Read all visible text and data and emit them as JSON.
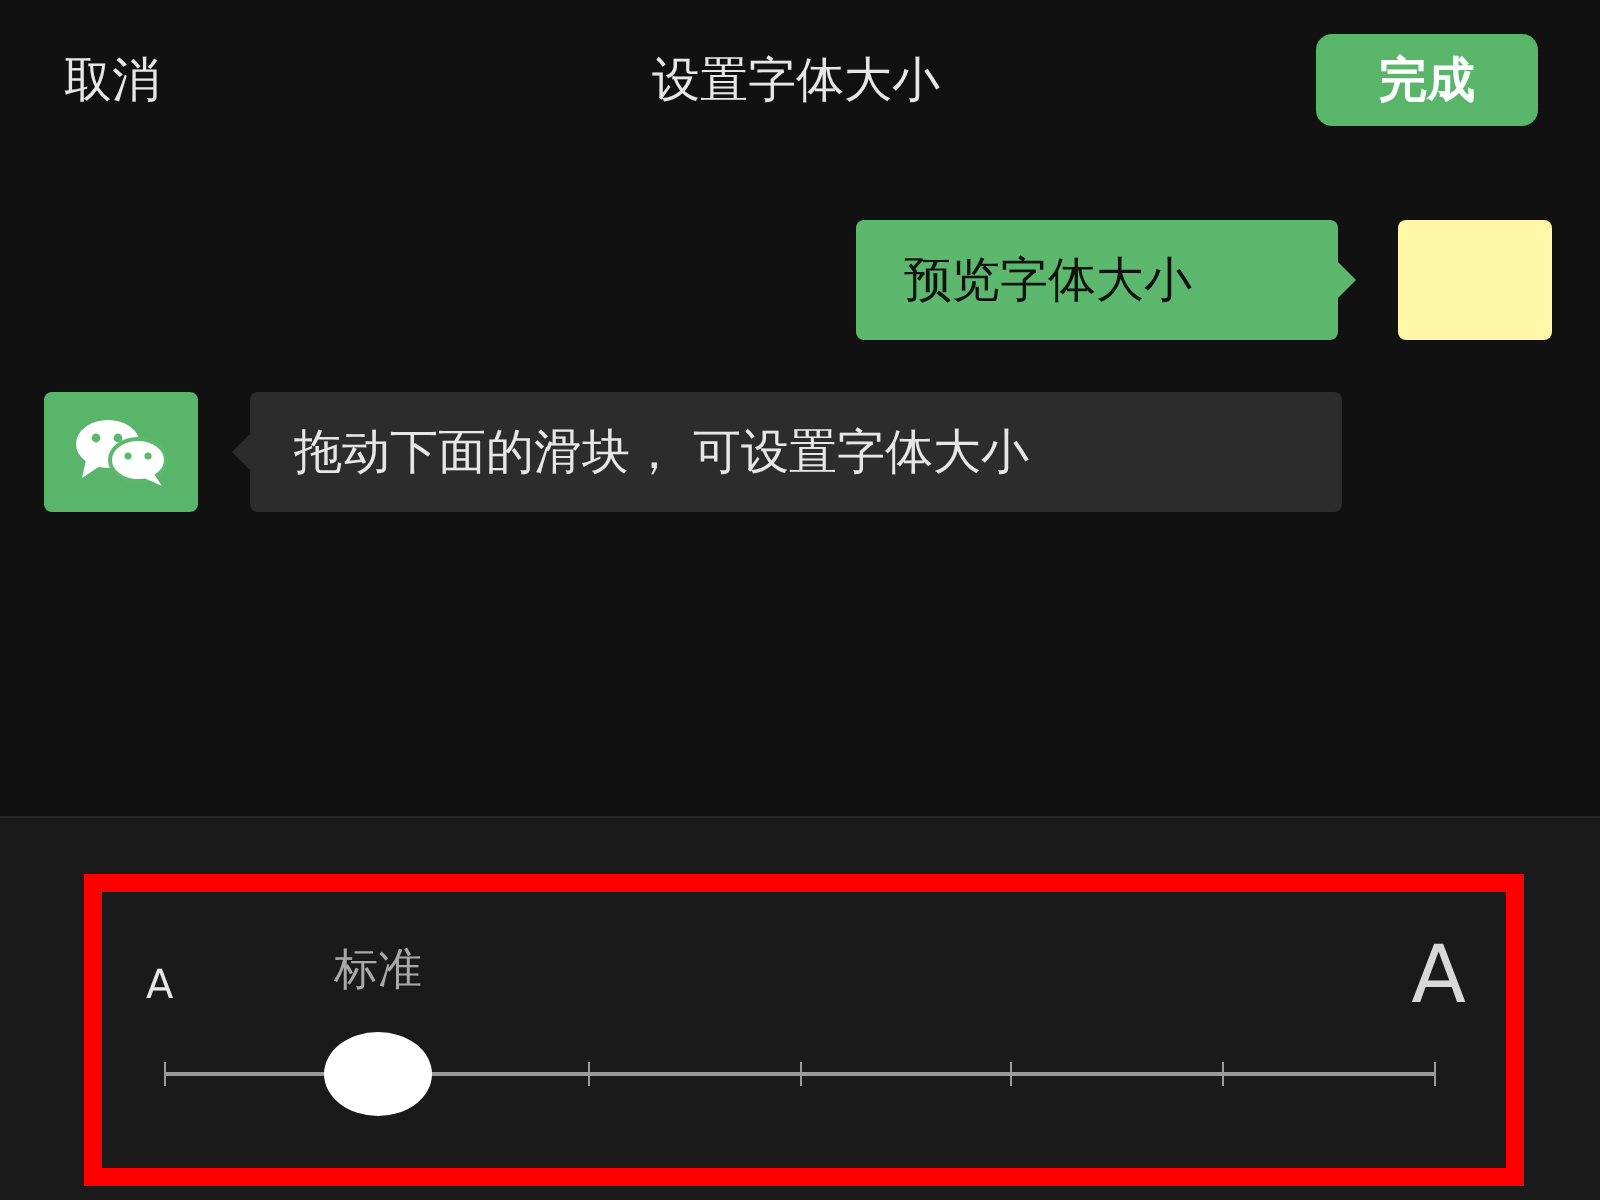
{
  "header": {
    "cancel": "取消",
    "title": "设置字体大小",
    "done": "完成"
  },
  "messages": [
    {
      "kind": "sent",
      "text": "预览字体大小"
    },
    {
      "kind": "received",
      "text": "拖动下面的滑块， 可设置字体大小"
    }
  ],
  "font_slider": {
    "small_label": "A",
    "large_label": "A",
    "current_label": "标准",
    "level": 0.1667,
    "highlighted": true
  }
}
